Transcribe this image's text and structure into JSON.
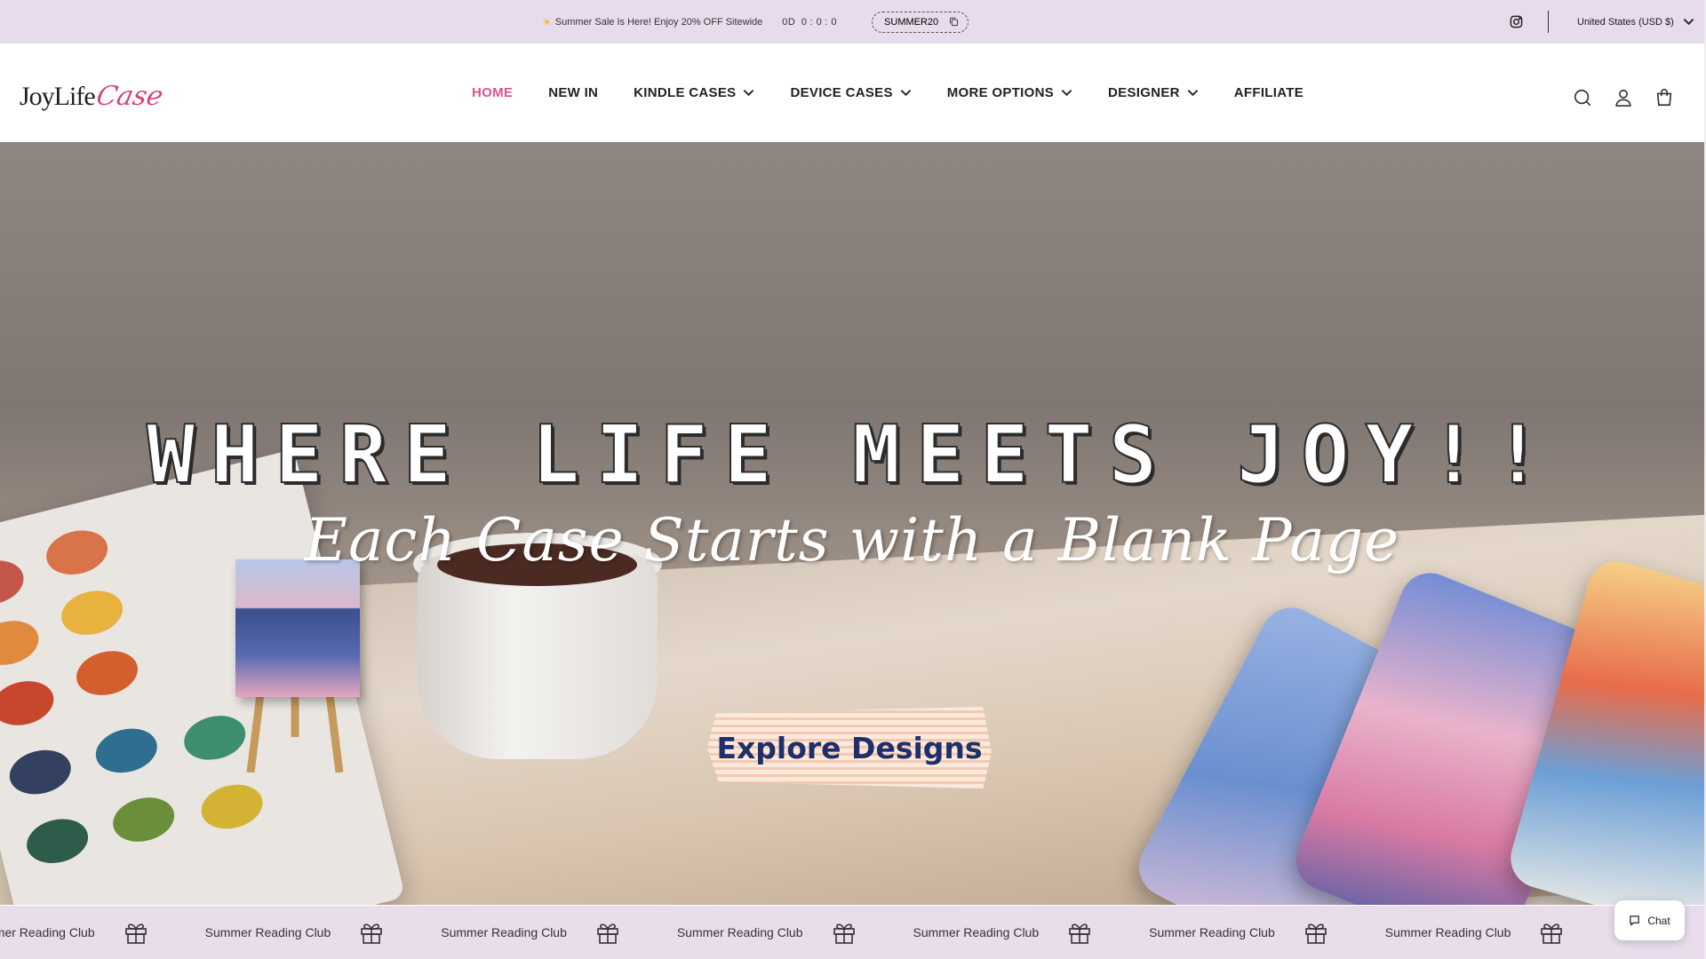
{
  "announcement": {
    "sun_icon": "sun-icon",
    "text": "Summer Sale Is Here! Enjoy 20% OFF Sitewide",
    "countdown": {
      "days": "0D",
      "hours": "0",
      "minutes": "0",
      "seconds": "0"
    },
    "coupon_code": "SUMMER20",
    "currency": "United States (USD $)"
  },
  "brand": {
    "logo_main": "JoyLife",
    "logo_script": "Case"
  },
  "nav": {
    "items": [
      {
        "label": "HOME",
        "active": true,
        "dropdown": false
      },
      {
        "label": "NEW IN",
        "active": false,
        "dropdown": false
      },
      {
        "label": "KINDLE CASES",
        "active": false,
        "dropdown": true
      },
      {
        "label": "DEVICE CASES",
        "active": false,
        "dropdown": true
      },
      {
        "label": "MORE OPTIONS",
        "active": false,
        "dropdown": true
      },
      {
        "label": "DESIGNER",
        "active": false,
        "dropdown": true
      },
      {
        "label": "AFFILIATE",
        "active": false,
        "dropdown": false
      }
    ]
  },
  "hero": {
    "title": "WHERE LIFE MEETS JOY!!",
    "subtitle": "Each Case Starts with a Blank Page",
    "cta_label": "Explore Designs"
  },
  "marquee": {
    "items": [
      "Summer Reading Club",
      "Summer Reading Club",
      "Summer Reading Club",
      "Summer Reading Club",
      "Summer Reading Club",
      "Summer Reading Club",
      "Summer Reading Club"
    ]
  },
  "chat": {
    "label": "Chat"
  },
  "colors": {
    "accent": "#d6558a",
    "announce_bg": "#e7dcec",
    "cta_text": "#1e2f6b"
  }
}
